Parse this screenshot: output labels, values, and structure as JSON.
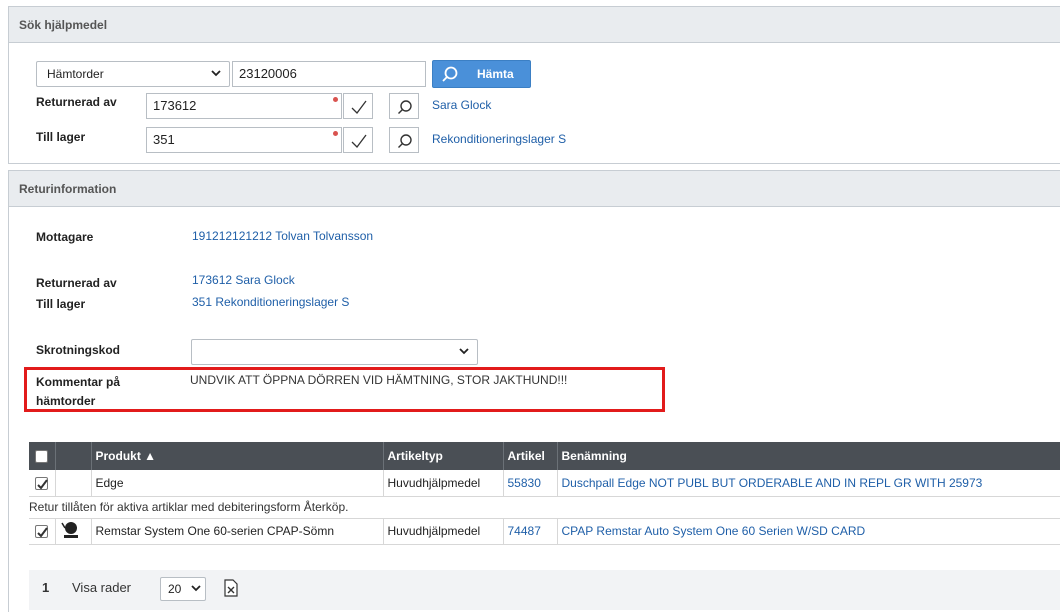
{
  "search_panel": {
    "title": "Sök hjälpmedel",
    "mode_select": "Hämtorder",
    "order_number": "23120006",
    "fetch_button": "Hämta",
    "returned_by_label": "Returnerad av",
    "returned_by_value": "173612",
    "returned_by_name": "Sara Glock",
    "to_stock_label": "Till lager",
    "to_stock_value": "351",
    "to_stock_name": "Rekonditioneringslager S"
  },
  "return_panel": {
    "title": "Returinformation",
    "recipient_label": "Mottagare",
    "recipient_value": "191212121212 Tolvan Tolvansson",
    "returned_by_label": "Returnerad av",
    "returned_by_value": "173612 Sara Glock",
    "to_stock_label": "Till lager",
    "to_stock_value": "351 Rekonditioneringslager S",
    "scrap_code_label": "Skrotningskod",
    "scrap_code_value": "",
    "comment_label_1": "Kommentar på",
    "comment_label_2": "hämtorder",
    "comment_value": "UNDVIK ATT ÖPPNA DÖRREN VID HÄMTNING, STOR JAKTHUND!!!",
    "highlight_color": "#e21b1b"
  },
  "table": {
    "headers": [
      "Produkt ▲",
      "Artikeltyp",
      "Artikel",
      "Benämning"
    ],
    "rows": [
      {
        "product": "Edge",
        "type": "Huvudhjälpmedel",
        "article": "55830",
        "name": "Duschpall Edge NOT PUBL BUT ORDERABLE AND IN REPL GR WITH 25973"
      },
      {
        "product": "Remstar System One 60-serien CPAP-Sömn",
        "type": "Huvudhjälpmedel",
        "article": "74487",
        "name": "CPAP Remstar Auto System One 60 Serien W/SD CARD"
      }
    ],
    "info_text": "Retur tillåten för aktiva artiklar med debiteringsform Återköp."
  },
  "pager": {
    "page": "1",
    "rows_label": "Visa rader",
    "rows_value": "20"
  }
}
